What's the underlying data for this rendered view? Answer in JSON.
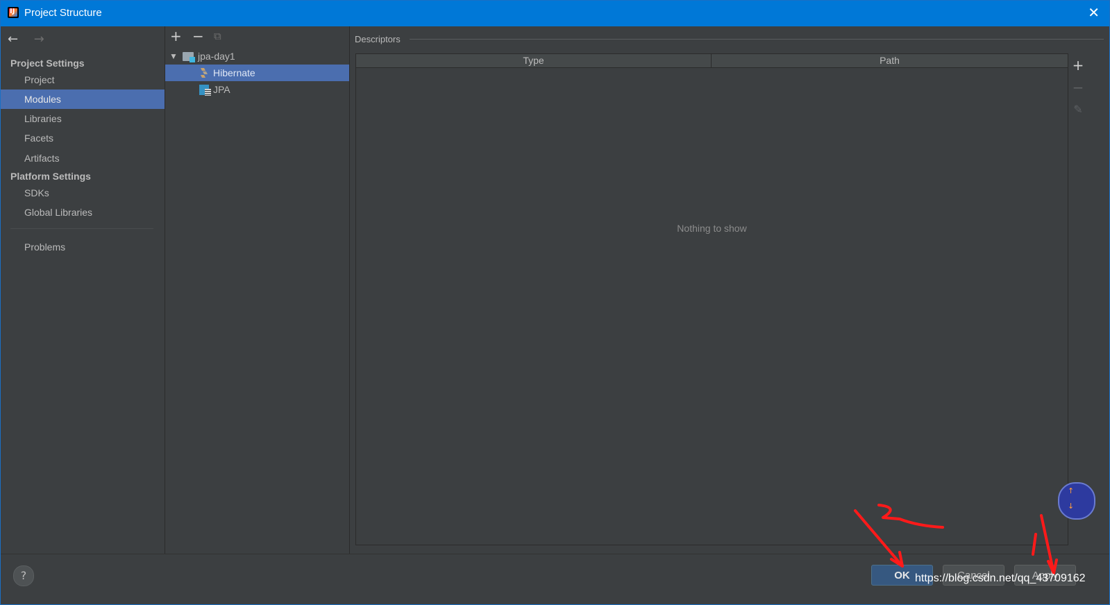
{
  "window": {
    "title": "Project Structure",
    "app_icon_letter": "IJ"
  },
  "left_nav": {
    "project_settings_title": "Project Settings",
    "project_settings_items": [
      "Project",
      "Modules",
      "Libraries",
      "Facets",
      "Artifacts"
    ],
    "platform_settings_title": "Platform Settings",
    "platform_settings_items": [
      "SDKs",
      "Global Libraries"
    ],
    "problems_label": "Problems",
    "selected": "Modules"
  },
  "tree": {
    "root": "jpa-day1",
    "children": [
      "Hibernate",
      "JPA"
    ],
    "selected": "Hibernate"
  },
  "descriptors": {
    "title": "Descriptors",
    "columns": [
      "Type",
      "Path"
    ],
    "empty_text": "Nothing to show"
  },
  "footer": {
    "help": "?",
    "ok": "OK",
    "cancel": "Cancel",
    "apply": "Apply",
    "watermark": "https://blog.csdn.net/qq_43709162"
  },
  "annotations": {
    "color": "#ff1a1a",
    "mark_1": "1",
    "mark_2": "2"
  }
}
